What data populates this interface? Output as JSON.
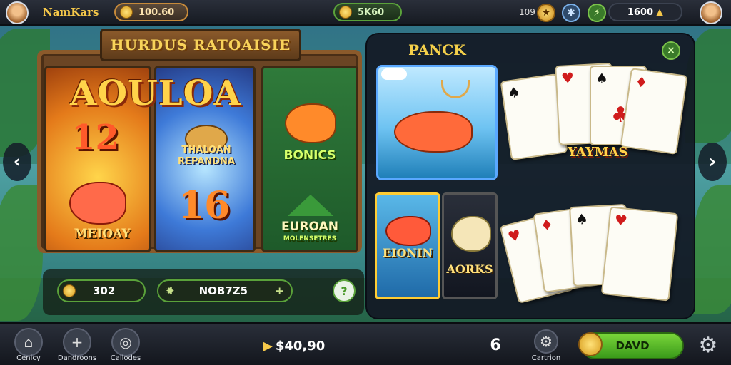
{
  "header": {
    "username": "NamKars",
    "currency_1": "100.60",
    "currency_2": "5K60",
    "level_text": "109",
    "gems": "1600"
  },
  "board": {
    "sign_title": "HURDUS RATOAISIE",
    "game_title": "AOULOA",
    "panel_a": {
      "number": "12",
      "label": "MEIOAY"
    },
    "panel_b": {
      "label": "THALOAN REPANDNA",
      "number": "16"
    },
    "panel_c": {
      "top_label": "BONICS",
      "bottom_label": "EUROAN",
      "bottom_sublabel": "MOLENSETRES"
    },
    "stats": {
      "coins": "302",
      "code": "NOB7Z5"
    },
    "help_label": "?"
  },
  "right_panel": {
    "title": "PANCK",
    "close_label": "×",
    "tile_labels": {
      "fish_1": "EIONIN",
      "fish_2": "AORKS"
    },
    "card_banner": "YAYMAS"
  },
  "navigation": {
    "prev_label": "‹",
    "next_label": "›"
  },
  "footer": {
    "nav": [
      {
        "label": "Cenicy"
      },
      {
        "label": "Dandroons"
      },
      {
        "label": "Callodes"
      }
    ],
    "balance": "$40,90",
    "six_label": "6",
    "settings_label": "Cartrion",
    "play_label": "DAVD"
  },
  "colors": {
    "gold": "#f5c84a",
    "green_accent": "#5aa23a",
    "bar_dark": "#161a22"
  }
}
